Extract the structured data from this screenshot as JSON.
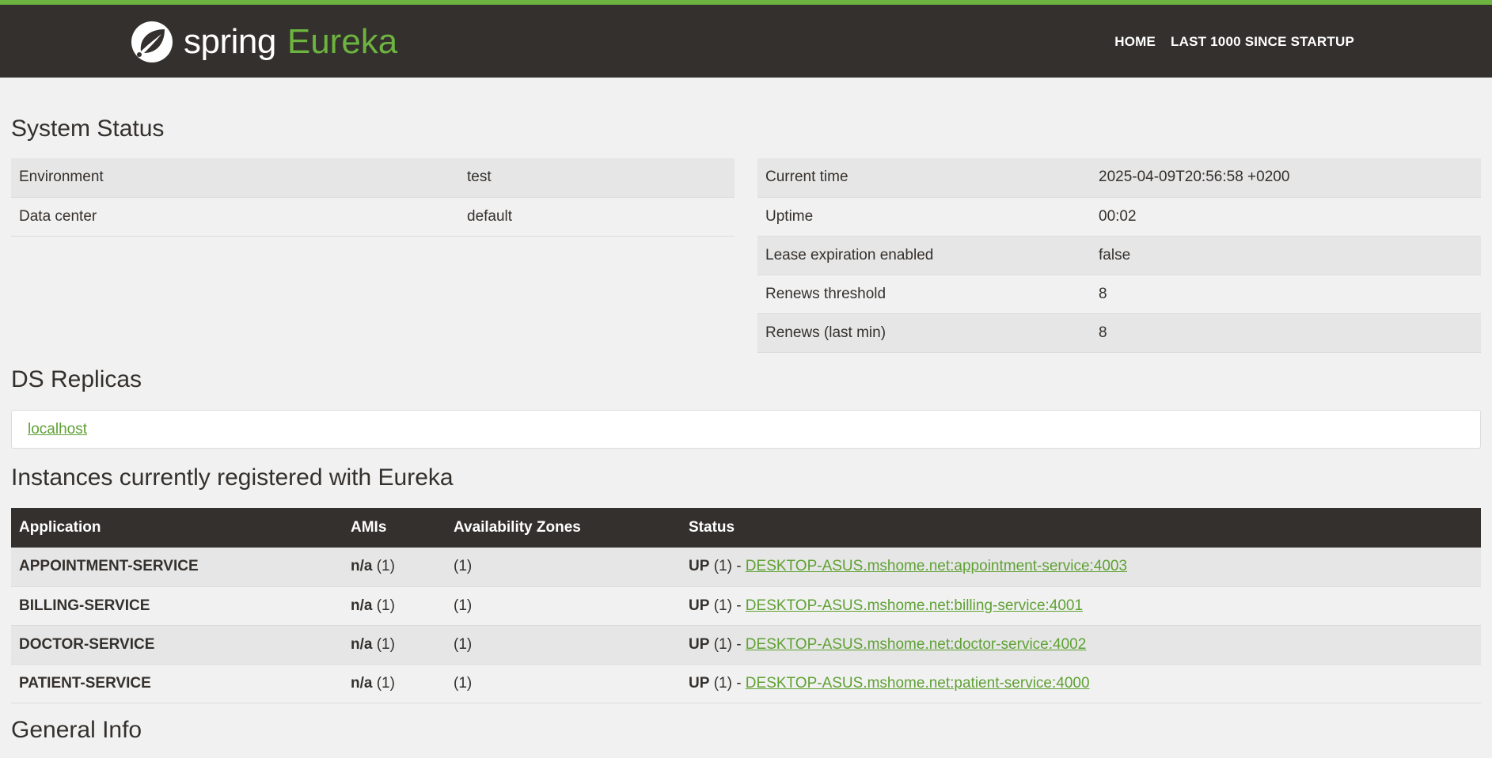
{
  "header": {
    "logo_spring": "spring",
    "logo_eureka": "Eureka",
    "nav": [
      "HOME",
      "LAST 1000 SINCE STARTUP"
    ]
  },
  "system_status": {
    "title": "System Status",
    "left": [
      {
        "label": "Environment",
        "value": "test"
      },
      {
        "label": "Data center",
        "value": "default"
      }
    ],
    "right": [
      {
        "label": "Current time",
        "value": "2025-04-09T20:56:58 +0200"
      },
      {
        "label": "Uptime",
        "value": "00:02"
      },
      {
        "label": "Lease expiration enabled",
        "value": "false"
      },
      {
        "label": "Renews threshold",
        "value": "8"
      },
      {
        "label": "Renews (last min)",
        "value": "8"
      }
    ]
  },
  "replicas": {
    "title": "DS Replicas",
    "link": "localhost"
  },
  "instances": {
    "title": "Instances currently registered with Eureka",
    "columns": [
      "Application",
      "AMIs",
      "Availability Zones",
      "Status"
    ],
    "rows": [
      {
        "app": "APPOINTMENT-SERVICE",
        "ami_bold": "n/a",
        "ami_count": "(1)",
        "zones": "(1)",
        "status_bold": "UP",
        "status_count": "(1) -",
        "link": "DESKTOP-ASUS.mshome.net:appointment-service:4003"
      },
      {
        "app": "BILLING-SERVICE",
        "ami_bold": "n/a",
        "ami_count": "(1)",
        "zones": "(1)",
        "status_bold": "UP",
        "status_count": "(1) -",
        "link": "DESKTOP-ASUS.mshome.net:billing-service:4001"
      },
      {
        "app": "DOCTOR-SERVICE",
        "ami_bold": "n/a",
        "ami_count": "(1)",
        "zones": "(1)",
        "status_bold": "UP",
        "status_count": "(1) -",
        "link": "DESKTOP-ASUS.mshome.net:doctor-service:4002"
      },
      {
        "app": "PATIENT-SERVICE",
        "ami_bold": "n/a",
        "ami_count": "(1)",
        "zones": "(1)",
        "status_bold": "UP",
        "status_count": "(1) -",
        "link": "DESKTOP-ASUS.mshome.net:patient-service:4000"
      }
    ]
  },
  "general_info": {
    "title": "General Info"
  },
  "colors": {
    "brand_green": "#6db33f",
    "header_dark": "#34302d",
    "link_green": "#5fa134"
  },
  "icons": {
    "logo": "spring-leaf-icon"
  }
}
